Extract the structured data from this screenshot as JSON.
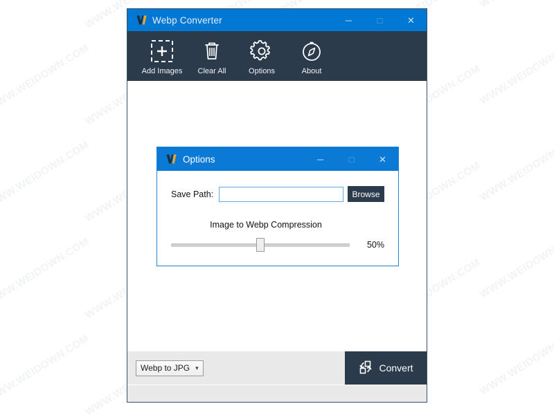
{
  "watermark": {
    "text": "WWW.WEIDOWN.COM",
    "color": "#f1f3f4"
  },
  "main_window": {
    "title": "Webp Converter",
    "logo_icon": "webp-logo-icon",
    "window_controls": [
      {
        "name": "minimize",
        "glyph": "─"
      },
      {
        "name": "maximize",
        "glyph": "□"
      },
      {
        "name": "close",
        "glyph": "✕"
      }
    ],
    "toolbar": {
      "items": [
        {
          "label": "Add Images",
          "icon": "add-images-icon"
        },
        {
          "label": "Clear All",
          "icon": "trash-icon"
        },
        {
          "label": "Options",
          "icon": "gear-icon"
        },
        {
          "label": "About",
          "icon": "compass-icon"
        }
      ]
    },
    "bottom_bar": {
      "format_select": {
        "value": "Webp to JPG",
        "caret_icon": "chevron-down-icon",
        "options": [
          "Webp to JPG"
        ]
      },
      "convert_button": {
        "label": "Convert",
        "icon": "convert-icon"
      }
    },
    "colors": {
      "titlebar": "#0078d4",
      "toolbar": "#2b3b4c",
      "accent_dark": "#2b3b4c",
      "bottom_bar": "#e9e9e9"
    }
  },
  "options_dialog": {
    "title": "Options",
    "logo_icon": "webp-logo-icon",
    "window_controls": [
      {
        "name": "minimize",
        "glyph": "─"
      },
      {
        "name": "maximize",
        "glyph": "□"
      },
      {
        "name": "close",
        "glyph": "✕"
      }
    ],
    "save_path": {
      "label": "Save Path:",
      "value": "",
      "placeholder": "",
      "browse_label": "Browse"
    },
    "compression": {
      "label": "Image to Webp Compression",
      "value_text": "50%",
      "value": 50,
      "min": 0,
      "max": 100
    }
  }
}
